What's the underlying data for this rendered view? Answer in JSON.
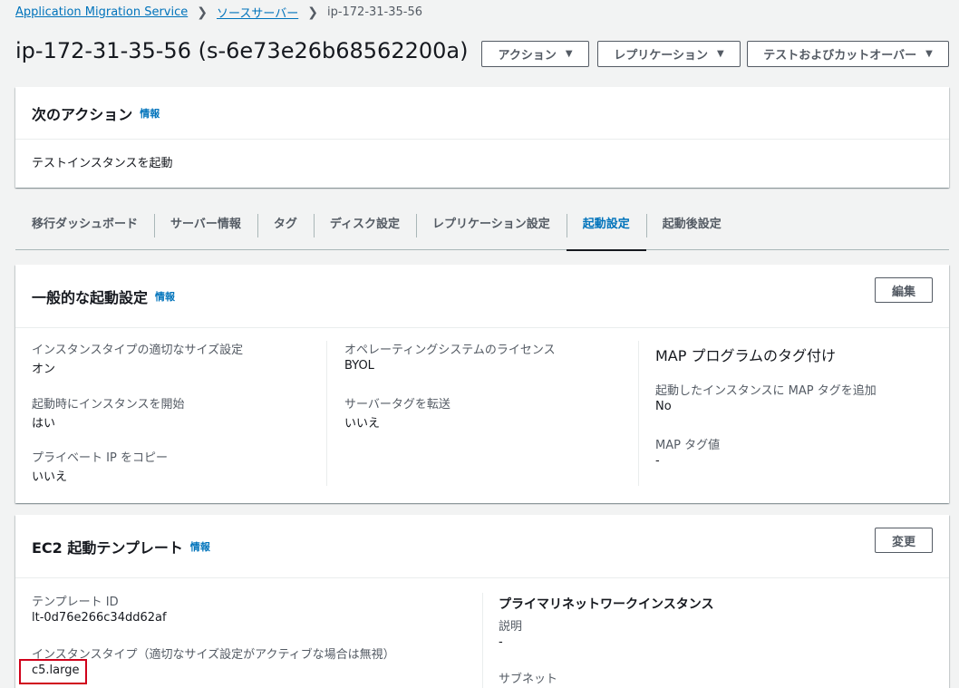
{
  "breadcrumb": {
    "root": "Application Migration Service",
    "level2": "ソースサーバー",
    "current": "ip-172-31-35-56"
  },
  "page_title": "ip-172-31-35-56 (s-6e73e26b68562200a)",
  "header_buttons": {
    "actions": "アクション",
    "replication": "レプリケーション",
    "test_cutover": "テストおよびカットオーバー"
  },
  "next_action": {
    "title": "次のアクション",
    "info": "情報",
    "body": "テストインスタンスを起動"
  },
  "tabs": [
    "移行ダッシュボード",
    "サーバー情報",
    "タグ",
    "ディスク設定",
    "レプリケーション設定",
    "起動設定",
    "起動後設定"
  ],
  "active_tab": "起動設定",
  "general_launch": {
    "title": "一般的な起動設定",
    "info": "情報",
    "edit": "編集",
    "col1": [
      {
        "label": "インスタンスタイプの適切なサイズ設定",
        "value": "オン"
      },
      {
        "label": "起動時にインスタンスを開始",
        "value": "はい"
      },
      {
        "label": "プライベート IP をコピー",
        "value": "いいえ"
      }
    ],
    "col2": [
      {
        "label": "オペレーティングシステムのライセンス",
        "value": "BYOL"
      },
      {
        "label": "サーバータグを転送",
        "value": "いいえ"
      }
    ],
    "col3": {
      "heading": "MAP プログラムのタグ付け",
      "items": [
        {
          "label": "起動したインスタンスに MAP タグを追加",
          "value": "No"
        },
        {
          "label": "MAP タグ値",
          "value": "-"
        }
      ]
    }
  },
  "ec2_template": {
    "title": "EC2 起動テンプレート",
    "info": "情報",
    "change": "変更",
    "template_id_label": "テンプレート ID",
    "template_id": "lt-0d76e266c34dd62af",
    "instance_type_label": "インスタンスタイプ（適切なサイズ設定がアクティブな場合は無視）",
    "instance_type": "c5.large",
    "primary_nic_heading": "プライマリネットワークインスタンス",
    "description_label": "説明",
    "description": "-",
    "subnet_label": "サブネット"
  },
  "colors": {
    "link": "#0073bb",
    "highlight": "#d0021b"
  }
}
